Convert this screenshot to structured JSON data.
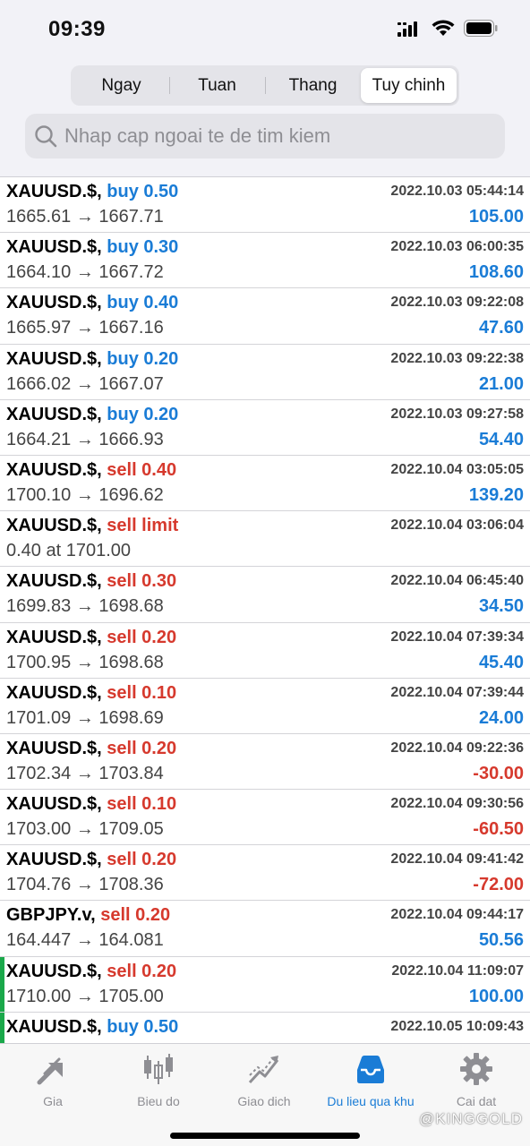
{
  "status_bar": {
    "time": "09:39"
  },
  "segments": {
    "items": [
      "Ngay",
      "Tuan",
      "Thang",
      "Tuy chinh"
    ],
    "selected": "Tuy chinh"
  },
  "search": {
    "placeholder": "Nhap cap ngoai te de tim kiem"
  },
  "colors": {
    "buy": "#1a7cd6",
    "sell": "#d6392d",
    "accent": "#1a7cd6",
    "marker": "#1aa84a"
  },
  "history": [
    {
      "symbol": "XAUUSD.$,",
      "side": "buy 0.50",
      "type": "buy",
      "time": "2022.10.03 05:44:14",
      "prices": "1665.61 → 1667.71",
      "profit": "105.00",
      "profit_sign": "pos",
      "marked": false
    },
    {
      "symbol": "XAUUSD.$,",
      "side": "buy 0.30",
      "type": "buy",
      "time": "2022.10.03 06:00:35",
      "prices": "1664.10 → 1667.72",
      "profit": "108.60",
      "profit_sign": "pos",
      "marked": false
    },
    {
      "symbol": "XAUUSD.$,",
      "side": "buy 0.40",
      "type": "buy",
      "time": "2022.10.03 09:22:08",
      "prices": "1665.97 → 1667.16",
      "profit": "47.60",
      "profit_sign": "pos",
      "marked": false
    },
    {
      "symbol": "XAUUSD.$,",
      "side": "buy 0.20",
      "type": "buy",
      "time": "2022.10.03 09:22:38",
      "prices": "1666.02 → 1667.07",
      "profit": "21.00",
      "profit_sign": "pos",
      "marked": false
    },
    {
      "symbol": "XAUUSD.$,",
      "side": "buy 0.20",
      "type": "buy",
      "time": "2022.10.03 09:27:58",
      "prices": "1664.21 → 1666.93",
      "profit": "54.40",
      "profit_sign": "pos",
      "marked": false
    },
    {
      "symbol": "XAUUSD.$,",
      "side": "sell 0.40",
      "type": "sell",
      "time": "2022.10.04 03:05:05",
      "prices": "1700.10 → 1696.62",
      "profit": "139.20",
      "profit_sign": "pos",
      "marked": false
    },
    {
      "symbol": "XAUUSD.$,",
      "side": "sell limit",
      "type": "sell",
      "time": "2022.10.04 03:06:04",
      "prices": "0.40 at 1701.00",
      "profit": "",
      "profit_sign": "pos",
      "marked": false
    },
    {
      "symbol": "XAUUSD.$,",
      "side": "sell 0.30",
      "type": "sell",
      "time": "2022.10.04 06:45:40",
      "prices": "1699.83 → 1698.68",
      "profit": "34.50",
      "profit_sign": "pos",
      "marked": false
    },
    {
      "symbol": "XAUUSD.$,",
      "side": "sell 0.20",
      "type": "sell",
      "time": "2022.10.04 07:39:34",
      "prices": "1700.95 → 1698.68",
      "profit": "45.40",
      "profit_sign": "pos",
      "marked": false
    },
    {
      "symbol": "XAUUSD.$,",
      "side": "sell 0.10",
      "type": "sell",
      "time": "2022.10.04 07:39:44",
      "prices": "1701.09 → 1698.69",
      "profit": "24.00",
      "profit_sign": "pos",
      "marked": false
    },
    {
      "symbol": "XAUUSD.$,",
      "side": "sell 0.20",
      "type": "sell",
      "time": "2022.10.04 09:22:36",
      "prices": "1702.34 → 1703.84",
      "profit": "-30.00",
      "profit_sign": "neg",
      "marked": false
    },
    {
      "symbol": "XAUUSD.$,",
      "side": "sell 0.10",
      "type": "sell",
      "time": "2022.10.04 09:30:56",
      "prices": "1703.00 → 1709.05",
      "profit": "-60.50",
      "profit_sign": "neg",
      "marked": false
    },
    {
      "symbol": "XAUUSD.$,",
      "side": "sell 0.20",
      "type": "sell",
      "time": "2022.10.04 09:41:42",
      "prices": "1704.76 → 1708.36",
      "profit": "-72.00",
      "profit_sign": "neg",
      "marked": false
    },
    {
      "symbol": "GBPJPY.v,",
      "side": "sell 0.20",
      "type": "sell",
      "time": "2022.10.04 09:44:17",
      "prices": "164.447 → 164.081",
      "profit": "50.56",
      "profit_sign": "pos",
      "marked": false
    },
    {
      "symbol": "XAUUSD.$,",
      "side": "sell 0.20",
      "type": "sell",
      "time": "2022.10.04 11:09:07",
      "prices": "1710.00 → 1705.00",
      "profit": "100.00",
      "profit_sign": "pos",
      "marked": true
    },
    {
      "symbol": "XAUUSD.$,",
      "side": "buy 0.50",
      "type": "buy",
      "time": "2022.10.05 10:09:43",
      "prices": "",
      "profit": "",
      "profit_sign": "pos",
      "marked": true
    }
  ],
  "tabbar": {
    "items": [
      {
        "label": "Gia",
        "icon": "quotes-arrows-icon",
        "active": false
      },
      {
        "label": "Bieu do",
        "icon": "candlestick-chart-icon",
        "active": false
      },
      {
        "label": "Giao dich",
        "icon": "trade-line-icon",
        "active": false
      },
      {
        "label": "Du lieu qua khu",
        "icon": "history-inbox-icon",
        "active": true
      },
      {
        "label": "Cai dat",
        "icon": "gear-icon",
        "active": false
      }
    ]
  },
  "watermark": "@KINGGOLD"
}
